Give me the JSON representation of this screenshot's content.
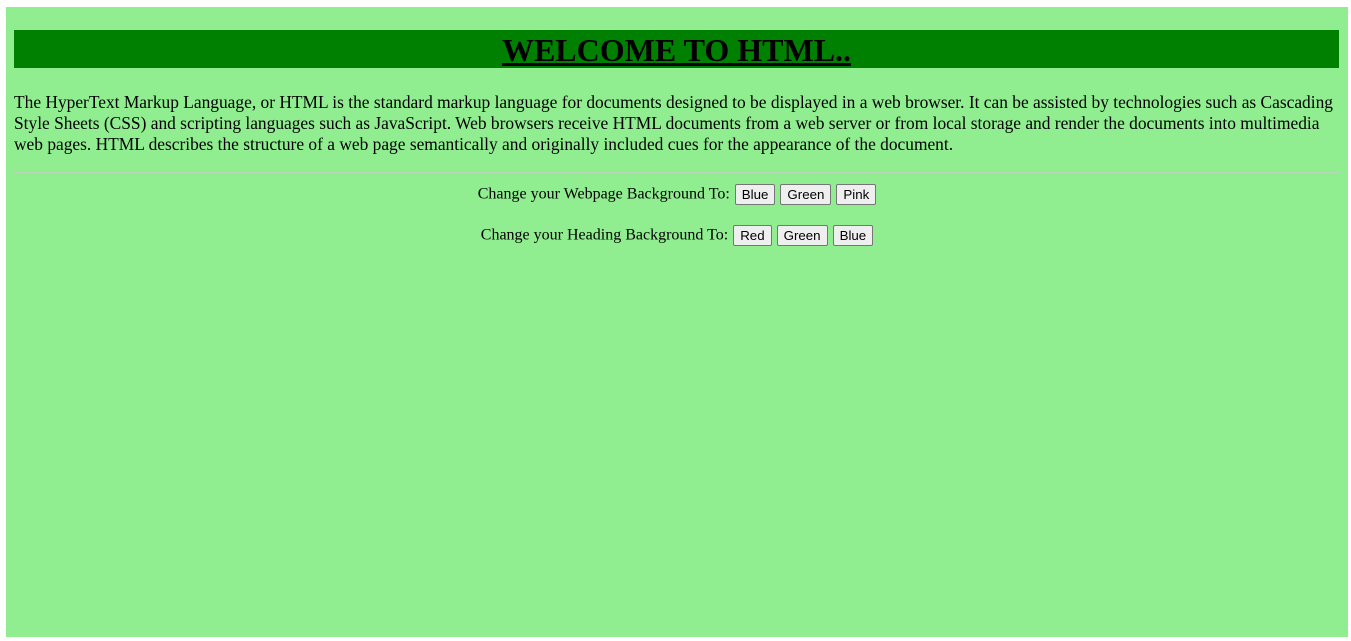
{
  "heading": {
    "text": "WELCOME TO HTML..",
    "background_color": "#008000"
  },
  "page": {
    "background_color": "#90ee90"
  },
  "paragraph": "The HyperText Markup Language, or HTML is the standard markup language for documents designed to be displayed in a web browser. It can be assisted by technologies such as Cascading Style Sheets (CSS) and scripting languages such as JavaScript. Web browsers receive HTML documents from a web server or from local storage and render the documents into multimedia web pages. HTML describes the structure of a web page semantically and originally included cues for the appearance of the document.",
  "page_background_controls": {
    "label": "Change your Webpage Background To:",
    "buttons": [
      "Blue",
      "Green",
      "Pink"
    ]
  },
  "heading_background_controls": {
    "label": "Change your Heading Background To:",
    "buttons": [
      "Red",
      "Green",
      "Blue"
    ]
  }
}
